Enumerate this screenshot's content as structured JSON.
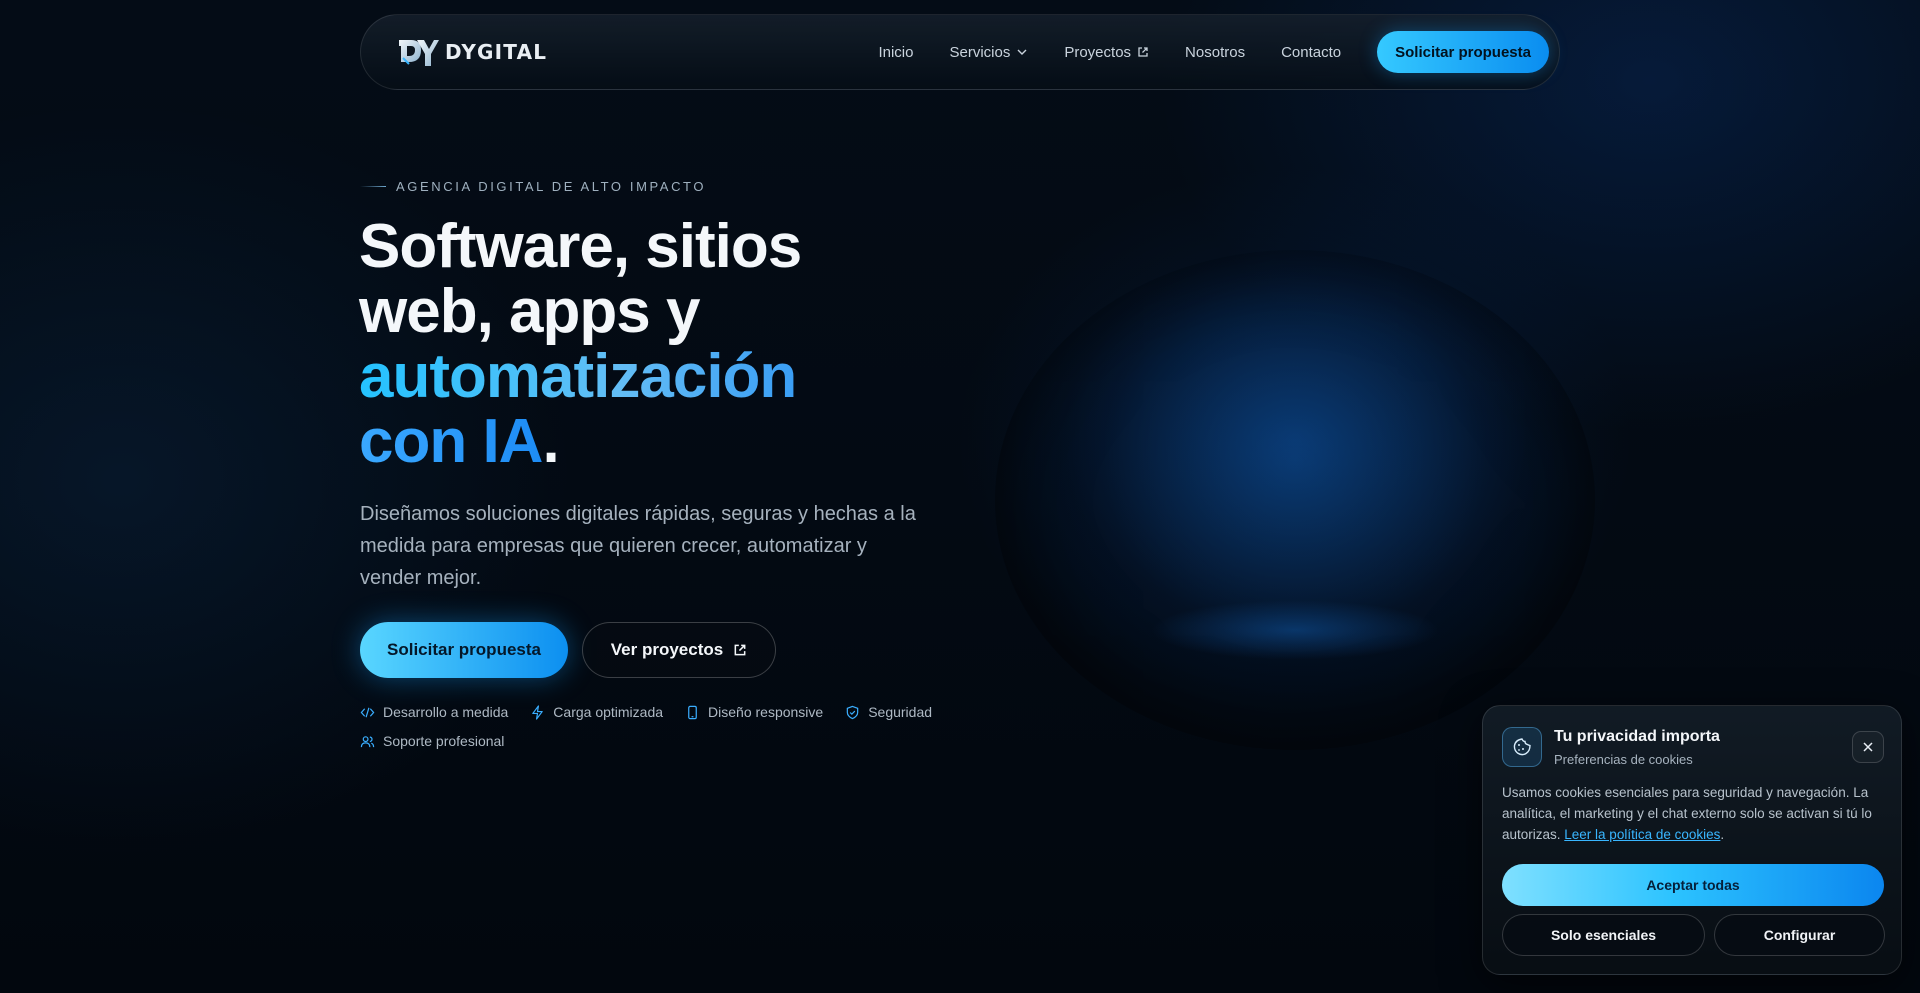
{
  "brand": {
    "name": "DYGITAL"
  },
  "nav": {
    "items": [
      {
        "label": "Inicio"
      },
      {
        "label": "Servicios",
        "icon": "chevron-down-icon"
      },
      {
        "label": "Proyectos",
        "icon": "external-link-icon"
      },
      {
        "label": "Nosotros"
      },
      {
        "label": "Contacto"
      }
    ],
    "cta_label": "Solicitar propuesta"
  },
  "hero": {
    "eyebrow": "AGENCIA DIGITAL DE ALTO IMPACTO",
    "headline_line1": "Software, sitios",
    "headline_line2": "web, apps y",
    "headline_accent1": "automatización",
    "headline_accent2": "con IA",
    "headline_period": ".",
    "subtitle": "Diseñamos soluciones digitales rápidas, seguras y hechas a la medida para empresas que quieren crecer, automatizar y vender mejor.",
    "primary_cta": "Solicitar propuesta",
    "secondary_cta": "Ver proyectos",
    "features": [
      {
        "label": "Desarrollo a medida",
        "icon": "code-icon"
      },
      {
        "label": "Carga optimizada",
        "icon": "lightning-icon"
      },
      {
        "label": "Diseño responsive",
        "icon": "smartphone-icon"
      },
      {
        "label": "Seguridad",
        "icon": "shield-check-icon"
      },
      {
        "label": "Soporte profesional",
        "icon": "users-icon"
      }
    ]
  },
  "cookie": {
    "title": "Tu privacidad importa",
    "subtitle": "Preferencias de cookies",
    "body": "Usamos cookies esenciales para seguridad y navegación. La analítica, el marketing y el chat externo solo se activan si tú lo autorizas. ",
    "policy_link": "Leer la política de cookies",
    "policy_suffix": ".",
    "accept_all": "Aceptar todas",
    "essentials_only": "Solo esenciales",
    "configure": "Configurar",
    "icon": "cookie-icon"
  },
  "colors": {
    "accent": "#2cc3ff",
    "accent_deep": "#0b86ef",
    "background": "#030a13"
  }
}
